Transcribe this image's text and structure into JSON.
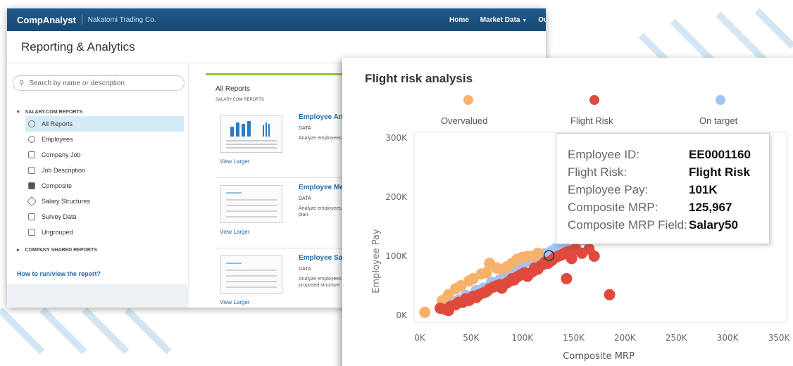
{
  "colors": {
    "brand": "#1e5a8c",
    "accent_green": "#8cc94a",
    "overvalued": "#f6b26b",
    "flight_risk": "#e04a3c",
    "on_target": "#a4c2f4"
  },
  "app": {
    "brand": "CompAnalyst",
    "company": "Nakatomi Trading Co.",
    "nav": {
      "home": "Home",
      "market_data": "Market Data",
      "our": "Our C"
    },
    "page_title": "Reporting & Analytics"
  },
  "sidebar": {
    "search_placeholder": "Search by name or description",
    "section1": "SALARY.COM REPORTS",
    "items": [
      {
        "label": "All Reports",
        "icon": "globe-icon"
      },
      {
        "label": "Employees",
        "icon": "people-icon"
      },
      {
        "label": "Company Job",
        "icon": "briefcase-icon"
      },
      {
        "label": "Job Description",
        "icon": "document-icon"
      },
      {
        "label": "Composite",
        "icon": "cube-icon"
      },
      {
        "label": "Salary Structures",
        "icon": "tag-icon"
      },
      {
        "label": "Survey Data",
        "icon": "clipboard-icon"
      },
      {
        "label": "Ungrouped",
        "icon": "clipboard-icon"
      }
    ],
    "section2": "COMPANY SHARED REPORTS",
    "help_link": "How to run/view the report?"
  },
  "main": {
    "title": "All Reports",
    "subtitle": "SALARY.COM REPORTS",
    "reports": [
      {
        "name": "Employee An",
        "type": "DATA",
        "desc": "Analyze employees",
        "view": "View Larger"
      },
      {
        "name": "Employee Me",
        "type": "DATA",
        "desc": "Analyze employees merit plan",
        "view": "View Larger"
      },
      {
        "name": "Employee Sal",
        "type": "DATA",
        "desc": "Analyze employees proposed structure",
        "view": "View Larger"
      }
    ]
  },
  "chart_panel": {
    "title": "Flight risk analysis",
    "tooltip": [
      {
        "label": "Employee ID:",
        "value": "EE0001160"
      },
      {
        "label": "Flight Risk:",
        "value": "Flight Risk"
      },
      {
        "label": "Employee Pay:",
        "value": "101K"
      },
      {
        "label": "Composite MRP:",
        "value": "125,967"
      },
      {
        "label": "Composite MRP Field:",
        "value": "Salary50"
      }
    ]
  },
  "chart_data": {
    "type": "scatter",
    "title": "Flight risk analysis",
    "xlabel": "Composite MRP",
    "ylabel": "Employee Pay",
    "xlim": [
      0,
      350000
    ],
    "ylim": [
      0,
      300000
    ],
    "xticks": [
      "0K",
      "50K",
      "100K",
      "150K",
      "200K",
      "250K",
      "300K",
      "350K"
    ],
    "yticks": [
      "0K",
      "100K",
      "200K",
      "300K"
    ],
    "legend_position": "top",
    "grid": true,
    "series": [
      {
        "name": "Overvalued",
        "color": "#f6b26b",
        "points": [
          [
            5000,
            5000
          ],
          [
            22000,
            25000
          ],
          [
            28000,
            35000
          ],
          [
            35000,
            45000
          ],
          [
            40000,
            50000
          ],
          [
            48000,
            58000
          ],
          [
            52000,
            62000
          ],
          [
            60000,
            70000
          ],
          [
            65000,
            72000
          ],
          [
            68000,
            88000
          ],
          [
            75000,
            80000
          ],
          [
            80000,
            78000
          ],
          [
            85000,
            82000
          ],
          [
            90000,
            88000
          ],
          [
            95000,
            95000
          ],
          [
            100000,
            98000
          ],
          [
            105000,
            100000
          ],
          [
            110000,
            100000
          ],
          [
            115000,
            105000
          ]
        ]
      },
      {
        "name": "Flight Risk",
        "color": "#e04a3c",
        "points": [
          [
            20000,
            12000
          ],
          [
            25000,
            10000
          ],
          [
            28000,
            8000
          ],
          [
            30000,
            15000
          ],
          [
            35000,
            18000
          ],
          [
            38000,
            22000
          ],
          [
            42000,
            22000
          ],
          [
            45000,
            28000
          ],
          [
            48000,
            25000
          ],
          [
            52000,
            32000
          ],
          [
            55000,
            30000
          ],
          [
            58000,
            35000
          ],
          [
            62000,
            38000
          ],
          [
            65000,
            40000
          ],
          [
            68000,
            45000
          ],
          [
            72000,
            48000
          ],
          [
            75000,
            50000
          ],
          [
            78000,
            52000
          ],
          [
            80000,
            46000
          ],
          [
            85000,
            55000
          ],
          [
            88000,
            58000
          ],
          [
            90000,
            62000
          ],
          [
            92000,
            60000
          ],
          [
            95000,
            65000
          ],
          [
            98000,
            68000
          ],
          [
            100000,
            70000
          ],
          [
            102000,
            72000
          ],
          [
            105000,
            66000
          ],
          [
            108000,
            72000
          ],
          [
            110000,
            74000
          ],
          [
            112000,
            80000
          ],
          [
            115000,
            78000
          ],
          [
            118000,
            84000
          ],
          [
            120000,
            86000
          ],
          [
            122000,
            90000
          ],
          [
            125000,
            88000
          ],
          [
            128000,
            92000
          ],
          [
            130000,
            95000
          ],
          [
            132000,
            98000
          ],
          [
            135000,
            100000
          ],
          [
            138000,
            102000
          ],
          [
            140000,
            104000
          ],
          [
            142000,
            106000
          ],
          [
            145000,
            108000
          ],
          [
            148000,
            96000
          ],
          [
            150000,
            110000
          ],
          [
            152000,
            112000
          ],
          [
            158000,
            105000
          ],
          [
            165000,
            112000
          ],
          [
            170000,
            100000
          ],
          [
            143000,
            62000
          ],
          [
            185000,
            35000
          ]
        ]
      },
      {
        "name": "On target",
        "color": "#a4c2f4",
        "points": [
          [
            25000,
            18000
          ],
          [
            30000,
            22000
          ],
          [
            38000,
            26000
          ],
          [
            45000,
            34000
          ],
          [
            55000,
            42000
          ],
          [
            62000,
            46000
          ],
          [
            70000,
            56000
          ],
          [
            78000,
            60000
          ],
          [
            85000,
            66000
          ],
          [
            90000,
            70000
          ],
          [
            95000,
            78000
          ],
          [
            100000,
            84000
          ],
          [
            105000,
            92000
          ],
          [
            108000,
            98000
          ],
          [
            112000,
            96000
          ],
          [
            118000,
            100000
          ],
          [
            122000,
            104000
          ],
          [
            128000,
            108000
          ],
          [
            132000,
            112000
          ],
          [
            136000,
            116000
          ],
          [
            140000,
            118000
          ],
          [
            145000,
            120000
          ],
          [
            150000,
            124000
          ],
          [
            155000,
            126000
          ],
          [
            160000,
            128000
          ],
          [
            165000,
            130000
          ]
        ]
      }
    ],
    "highlight": {
      "x": 125967,
      "y": 101000
    }
  }
}
